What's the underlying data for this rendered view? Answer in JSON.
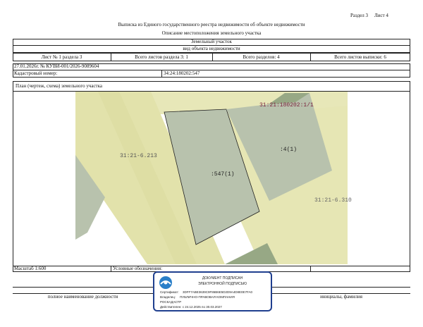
{
  "header": {
    "section": "Раздел 3",
    "sheet": "Лист 4",
    "title": "Выписка из Единого государственного реестра недвижимости об объекте недвижимости",
    "subtitle": "Описание местоположения земельного участка"
  },
  "object": {
    "type": "Земельный участок",
    "kind": "вид объекта недвижимости"
  },
  "sheet_row": {
    "sheet_of_section": "Лист № 1 раздела 3",
    "total_sheets_section": "Всего листов раздела 3: 1",
    "total_sections": "Всего разделов: 4",
    "total_sheets_extract": "Всего листов выписки: 6"
  },
  "doc_number": "27.01.2026г. № КУВИ-001/2026-9089604",
  "cadastral": {
    "label": "Кадастровый номер:",
    "value": "34:24:180202:547"
  },
  "plan_title": "План (чертеж, схема) земельного участка",
  "map_labels": {
    "parcel_top": "31:21:180202:1/1",
    "road_left": "31:21-6.213",
    "center_parcel": ":547(1)",
    "right_parcel": ":4(1)",
    "road_right": "31:21-6.310"
  },
  "colors": {
    "road": "#e6e6b4",
    "parcel": "#b8c2ad",
    "parcel_dark": "#97a885",
    "accent_text": "#7a1f3a"
  },
  "footer": {
    "scale": "Масштаб 1:600",
    "legend": "Условные обозначения:",
    "position_caption": "полное наименование должности",
    "name_caption": "инициалы, фамилия"
  },
  "stamp": {
    "line1": "ДОКУМЕНТ ПОДПИСАН",
    "line2": "ЭЛЕКТРОННОЙ ПОДПИСЬЮ",
    "cert_label": "Сертификат:",
    "cert_value": "3DFF7ABE3639C9F86B6E5D2D9A4D8E0E7FA0",
    "owner_label": "Владелец:",
    "owner_value": "ПУБЛИЧНО-ПРАВОВАЯ КОМПАНИЯ",
    "owner_value2": "РОСКАДАСТР",
    "valid": "Действителен: с 24.12.2025 по 30.03.2027"
  }
}
